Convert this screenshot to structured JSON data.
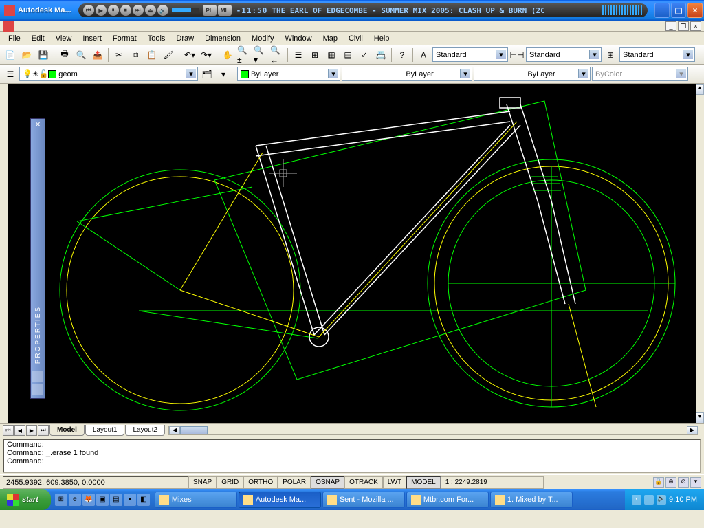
{
  "title": "Autodesk Ma...",
  "winamp": {
    "time": "-11:50",
    "track": "THE EARL OF EDGECOMBE - SUMMER MIX 2005: CLASH UP & BURN (2C",
    "pill1": "PL",
    "pill2": "ML"
  },
  "menu": [
    "File",
    "Edit",
    "View",
    "Insert",
    "Format",
    "Tools",
    "Draw",
    "Dimension",
    "Modify",
    "Window",
    "Map",
    "Civil",
    "Help"
  ],
  "styles": {
    "text": "Standard",
    "dim": "Standard",
    "table": "Standard"
  },
  "layer": {
    "name": "geom",
    "color": "#00ff00"
  },
  "props": {
    "color_label": "ByLayer",
    "ltype": "ByLayer",
    "lweight": "ByLayer",
    "plotstyle": "ByColor"
  },
  "panel": {
    "title": "PROPERTIES"
  },
  "tabs": {
    "model": "Model",
    "l1": "Layout1",
    "l2": "Layout2"
  },
  "cmd": {
    "l1": "Command:",
    "l2": "Command: _.erase 1 found",
    "l3": "Command:"
  },
  "status": {
    "coords": "2455.9392, 609.3850, 0.0000",
    "snap": "SNAP",
    "grid": "GRID",
    "ortho": "ORTHO",
    "polar": "POLAR",
    "osnap": "OSNAP",
    "otrack": "OTRACK",
    "lwt": "LWT",
    "model": "MODEL",
    "scale": "1 : 2249.2819"
  },
  "taskbar": {
    "start": "start",
    "items": [
      {
        "label": "Mixes"
      },
      {
        "label": "Autodesk Ma..."
      },
      {
        "label": "Sent - Mozilla ..."
      },
      {
        "label": "Mtbr.com For..."
      },
      {
        "label": "1. Mixed by T..."
      }
    ],
    "clock": "9:10 PM"
  }
}
